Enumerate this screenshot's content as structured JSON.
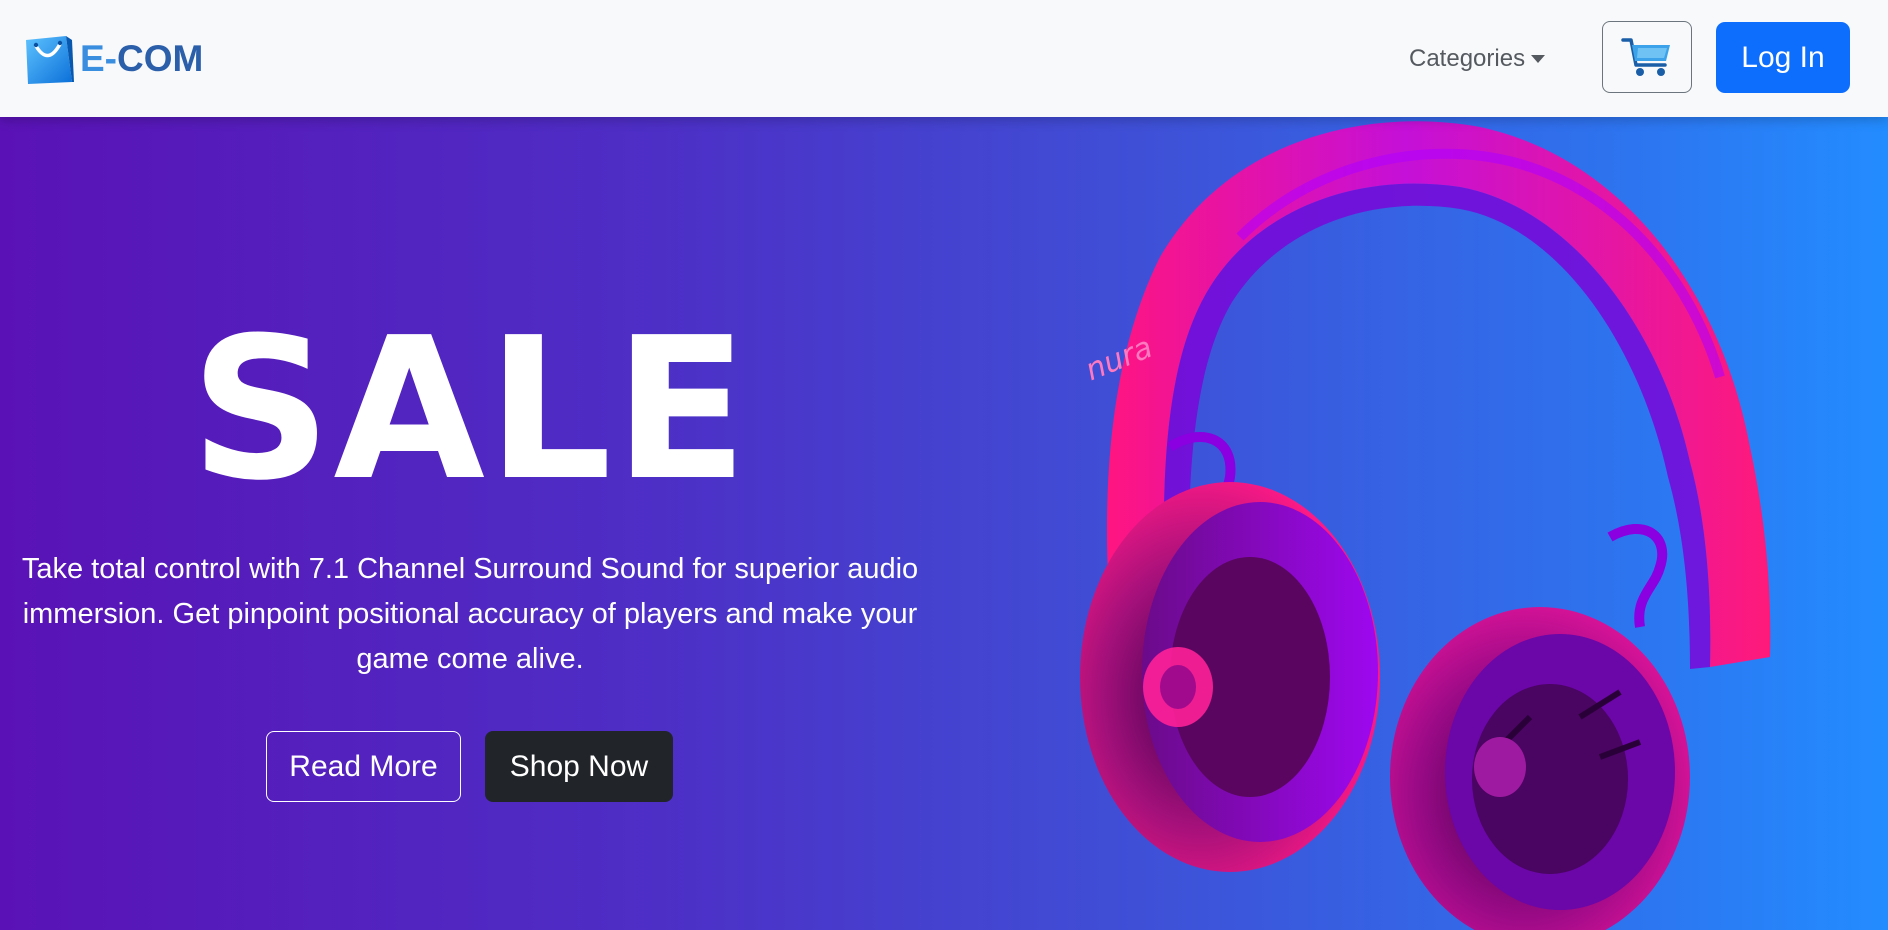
{
  "brand": {
    "name_prefix": "E-",
    "name_suffix": "COM",
    "icon": "shopping-bag-icon"
  },
  "nav": {
    "categories_label": "Categories",
    "cart_icon": "cart-icon",
    "login_label": "Log In"
  },
  "hero": {
    "title": "SALE",
    "description": "Take total control with 7.1 Channel Surround Sound for superior audio immersion. Get pinpoint positional accuracy of players and make your game come alive.",
    "read_more_label": "Read More",
    "shop_now_label": "Shop Now",
    "product_logo_text": "nura"
  },
  "colors": {
    "primary": "#0d6efd",
    "dark": "#212529",
    "gradient_start": "#5a12b6",
    "gradient_end": "#238cff",
    "headphone_pink": "#ff1a8c",
    "headphone_purple": "#8a00f0"
  }
}
